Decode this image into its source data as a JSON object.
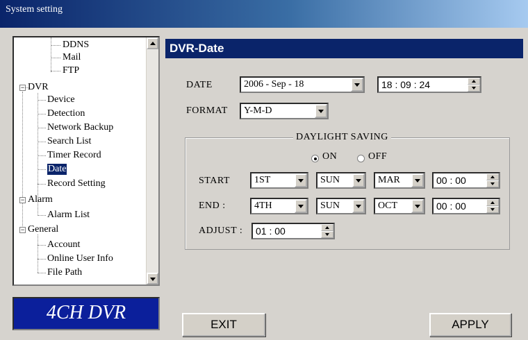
{
  "window": {
    "title": "System setting"
  },
  "tree": {
    "items": [
      {
        "label": "DDNS"
      },
      {
        "label": "Mail"
      },
      {
        "label": "FTP"
      },
      {
        "label": "DVR"
      },
      {
        "label": "Device"
      },
      {
        "label": "Detection"
      },
      {
        "label": "Network Backup"
      },
      {
        "label": "Search List"
      },
      {
        "label": "Timer Record"
      },
      {
        "label": "Date",
        "selected": true
      },
      {
        "label": "Record Setting"
      },
      {
        "label": "Alarm"
      },
      {
        "label": "Alarm List"
      },
      {
        "label": "General"
      },
      {
        "label": "Account"
      },
      {
        "label": "Online User Info"
      },
      {
        "label": "File Path"
      }
    ]
  },
  "logo": {
    "text": "4CH DVR"
  },
  "panel": {
    "title": "DVR-Date",
    "date_label": "DATE",
    "date_value": "2006 -  Sep   - 18",
    "time_value": "18 : 09 : 24",
    "format_label": "FORMAT",
    "format_value": "Y-M-D",
    "daylight": {
      "title": "DAYLIGHT SAVING",
      "on_label": "ON",
      "off_label": "OFF",
      "selected": "ON",
      "start_label": "START",
      "start": {
        "week": "1ST",
        "day": "SUN",
        "month": "MAR",
        "time": "00 : 00"
      },
      "end_label": "END :",
      "end": {
        "week": "4TH",
        "day": "SUN",
        "month": "OCT",
        "time": "00 : 00"
      },
      "adjust_label": "ADJUST :",
      "adjust_value": "01 : 00"
    }
  },
  "buttons": {
    "exit": "EXIT",
    "apply": "APPLY"
  },
  "colors": {
    "title_bar": "#0a246a",
    "panel_header": "#0a246a",
    "logo_bg": "#0b1f9b",
    "window_bg": "#d6d3ce"
  }
}
